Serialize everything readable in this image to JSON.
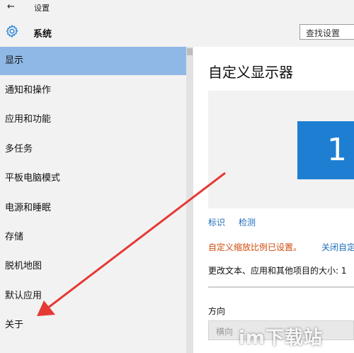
{
  "window": {
    "title": "设置"
  },
  "header": {
    "title": "系统",
    "search_placeholder": "查找设置"
  },
  "sidebar": {
    "items": [
      {
        "label": "显示",
        "active": true
      },
      {
        "label": "通知和操作"
      },
      {
        "label": "应用和功能"
      },
      {
        "label": "多任务"
      },
      {
        "label": "平板电脑模式"
      },
      {
        "label": "电源和睡眠"
      },
      {
        "label": "存储"
      },
      {
        "label": "脱机地图"
      },
      {
        "label": "默认应用"
      },
      {
        "label": "关于"
      }
    ]
  },
  "main": {
    "title": "自定义显示器",
    "monitor_number": "1",
    "identify_link": "标识",
    "detect_link": "检测",
    "scale_notice": "自定义缩放比例已设置。",
    "scale_notice_link": "关闭自定",
    "scale_text": "更改文本、应用和其他项目的大小: 1",
    "orientation_label": "方向",
    "orientation_value": "横向"
  },
  "watermark": "im下载站",
  "colors": {
    "accent": "#1e7fd2",
    "active_item": "#8fb8e6",
    "link": "#1c6ebc",
    "warning": "#d14a0b",
    "annotation_arrow": "#e53935"
  },
  "icons": {
    "back": "back-arrow-icon",
    "settings": "gear-icon"
  }
}
